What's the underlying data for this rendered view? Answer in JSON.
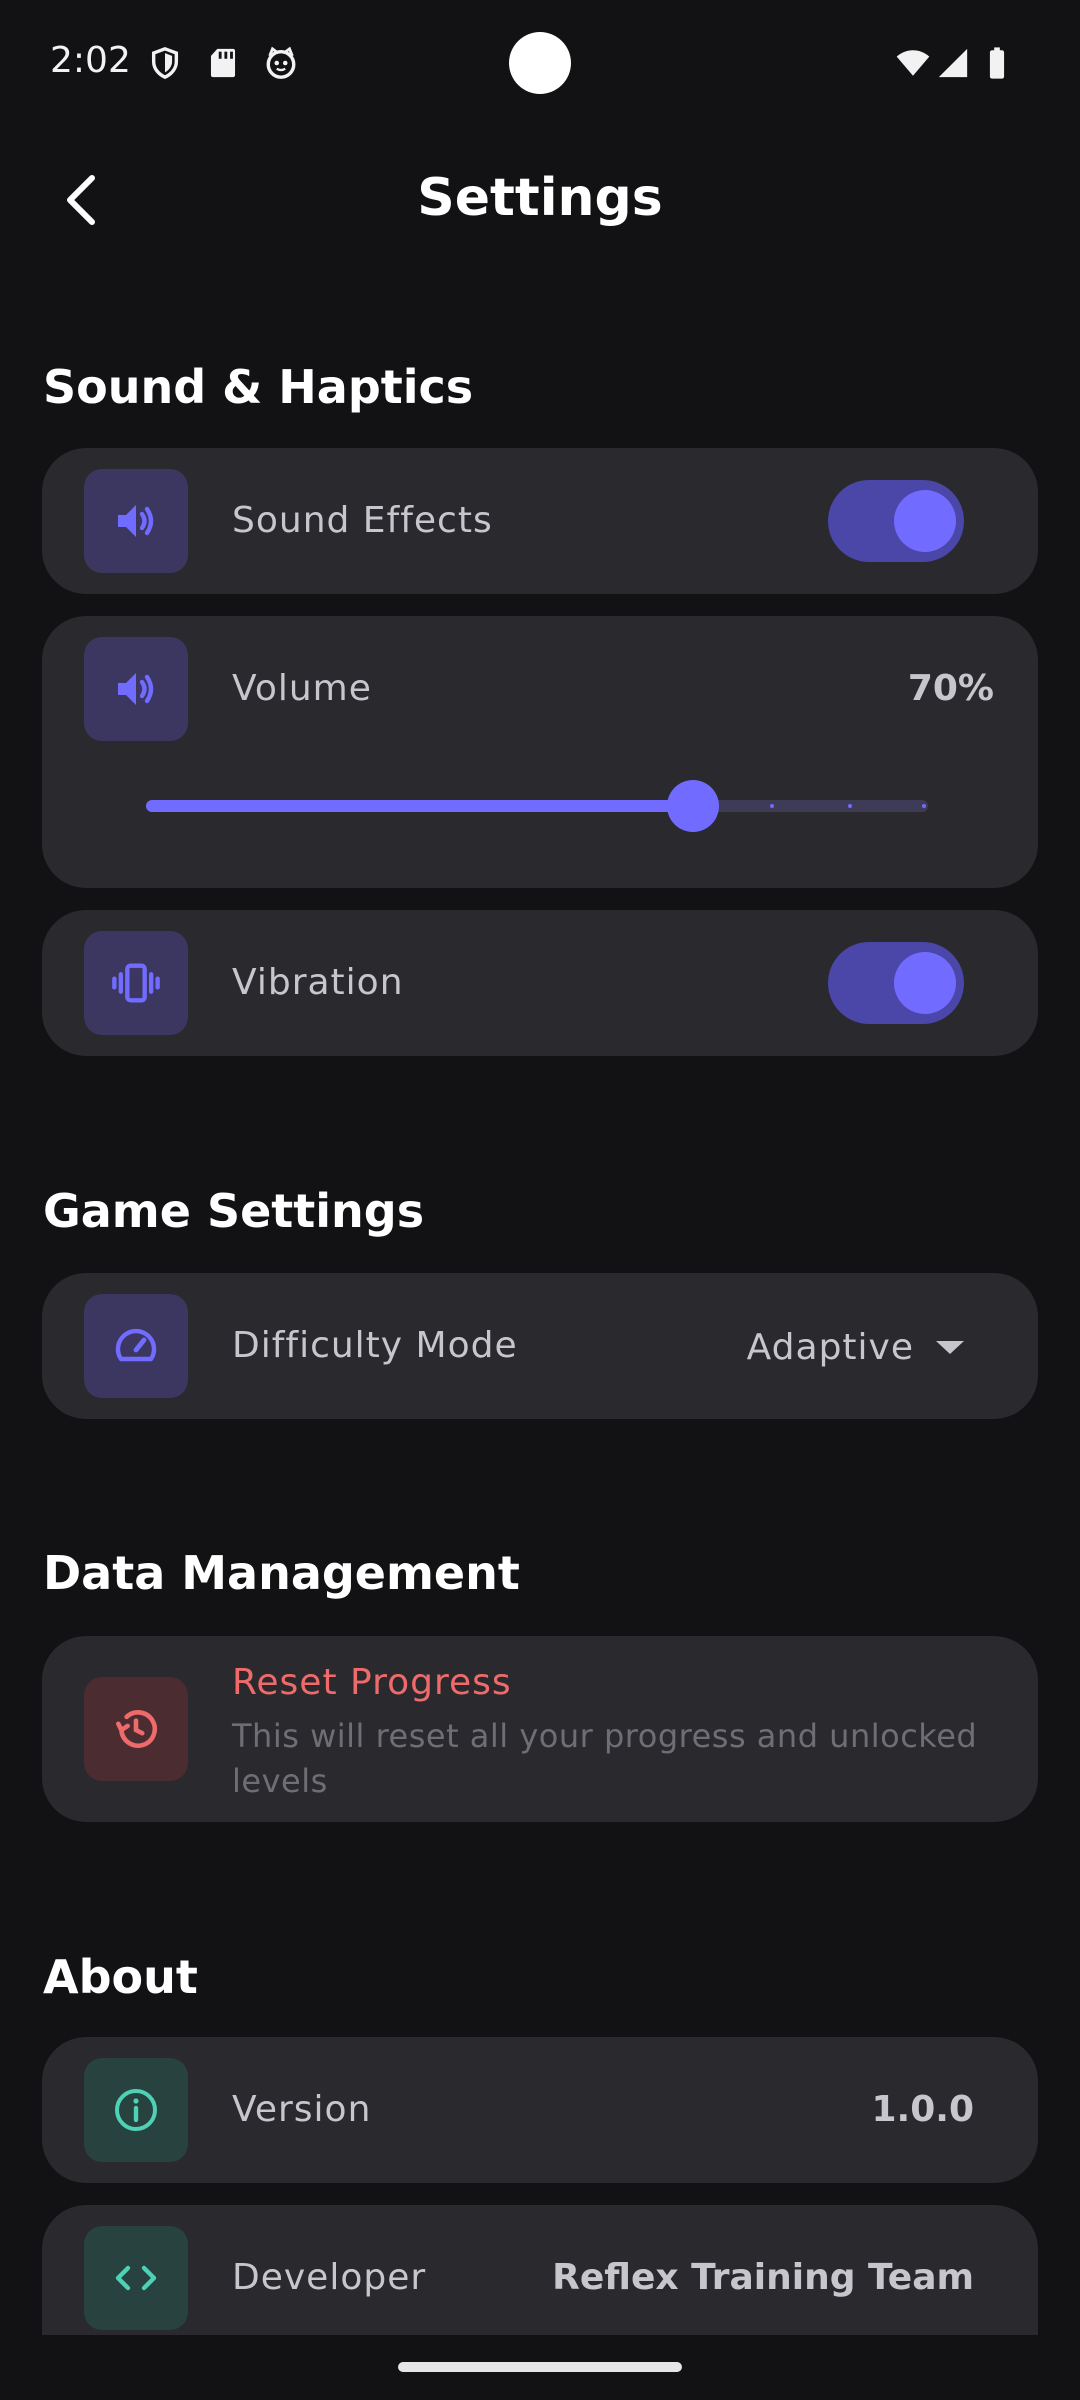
{
  "status_bar": {
    "time": "2:02",
    "icons": [
      "shield-icon",
      "sd-card-icon",
      "cat-face-icon",
      "wifi-icon",
      "signal-icon",
      "battery-icon"
    ]
  },
  "app_bar": {
    "title": "Settings",
    "back_icon": "chevron-left-icon"
  },
  "sections": {
    "sound_haptics": {
      "title": "Sound & Haptics",
      "sound_effects": {
        "label": "Sound Effects",
        "icon": "speaker-icon",
        "enabled": true
      },
      "volume": {
        "label": "Volume",
        "icon": "speaker-icon",
        "value_text": "70%",
        "value": 0.7
      },
      "vibration": {
        "label": "Vibration",
        "icon": "vibration-icon",
        "enabled": true
      }
    },
    "game_settings": {
      "title": "Game Settings",
      "difficulty": {
        "label": "Difficulty Mode",
        "icon": "speedometer-icon",
        "selected": "Adaptive"
      }
    },
    "data_management": {
      "title": "Data Management",
      "reset": {
        "label": "Reset Progress",
        "description": "This will reset all your progress and unlocked levels",
        "icon": "history-icon"
      }
    },
    "about": {
      "title": "About",
      "version": {
        "label": "Version",
        "value": "1.0.0",
        "icon": "info-icon"
      },
      "developer": {
        "label": "Developer",
        "value": "Reflex Training Team",
        "icon": "code-icon"
      }
    }
  },
  "colors": {
    "background": "#121114",
    "card": "#2a292d",
    "accent": "#716cff",
    "toggle_track": "#4a47a8",
    "danger": "#ef6b6b",
    "teal": "#4fd1b5"
  }
}
